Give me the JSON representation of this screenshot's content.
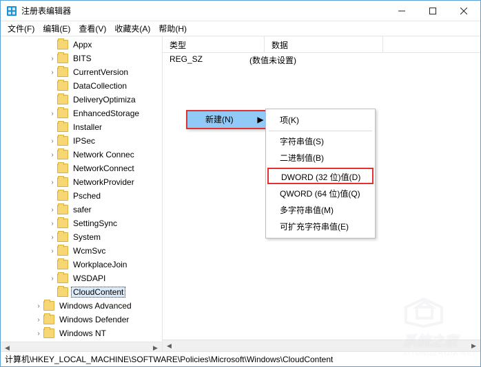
{
  "window": {
    "title": "注册表编辑器"
  },
  "menu": {
    "file": "文件(F)",
    "edit": "编辑(E)",
    "view": "查看(V)",
    "favorites": "收藏夹(A)",
    "help": "帮助(H)"
  },
  "tree": {
    "items": [
      {
        "label": "Appx",
        "has_children": false
      },
      {
        "label": "BITS",
        "has_children": true
      },
      {
        "label": "CurrentVersion",
        "has_children": true
      },
      {
        "label": "DataCollection",
        "has_children": false
      },
      {
        "label": "DeliveryOptimiza",
        "has_children": false
      },
      {
        "label": "EnhancedStorage",
        "has_children": true
      },
      {
        "label": "Installer",
        "has_children": false
      },
      {
        "label": "IPSec",
        "has_children": true
      },
      {
        "label": "Network Connec",
        "has_children": true
      },
      {
        "label": "NetworkConnect",
        "has_children": false
      },
      {
        "label": "NetworkProvider",
        "has_children": true
      },
      {
        "label": "Psched",
        "has_children": false
      },
      {
        "label": "safer",
        "has_children": true
      },
      {
        "label": "SettingSync",
        "has_children": true
      },
      {
        "label": "System",
        "has_children": true
      },
      {
        "label": "WcmSvc",
        "has_children": true
      },
      {
        "label": "WorkplaceJoin",
        "has_children": false
      },
      {
        "label": "WSDAPI",
        "has_children": true
      },
      {
        "label": "CloudContent",
        "has_children": false,
        "selected": true
      }
    ],
    "tail": [
      {
        "label": "Windows Advanced",
        "has_children": true
      },
      {
        "label": "Windows Defender",
        "has_children": true
      },
      {
        "label": "Windows NT",
        "has_children": true
      }
    ]
  },
  "list": {
    "cols": {
      "type": "类型",
      "data": "数据"
    },
    "rows": [
      {
        "name": "",
        "type": "REG_SZ",
        "data": "(数值未设置)"
      }
    ]
  },
  "ctx1": {
    "new": "新建(N)"
  },
  "ctx2": {
    "key": "项(K)",
    "string": "字符串值(S)",
    "binary": "二进制值(B)",
    "dword": "DWORD (32 位)值(D)",
    "qword": "QWORD (64 位)值(Q)",
    "multi": "多字符串值(M)",
    "expand": "可扩充字符串值(E)"
  },
  "statusbar": "计算机\\HKEY_LOCAL_MACHINE\\SOFTWARE\\Policies\\Microsoft\\Windows\\CloudContent",
  "watermark": {
    "text": "系统之家",
    "sub": "XITONGZHIJIA.NET"
  }
}
